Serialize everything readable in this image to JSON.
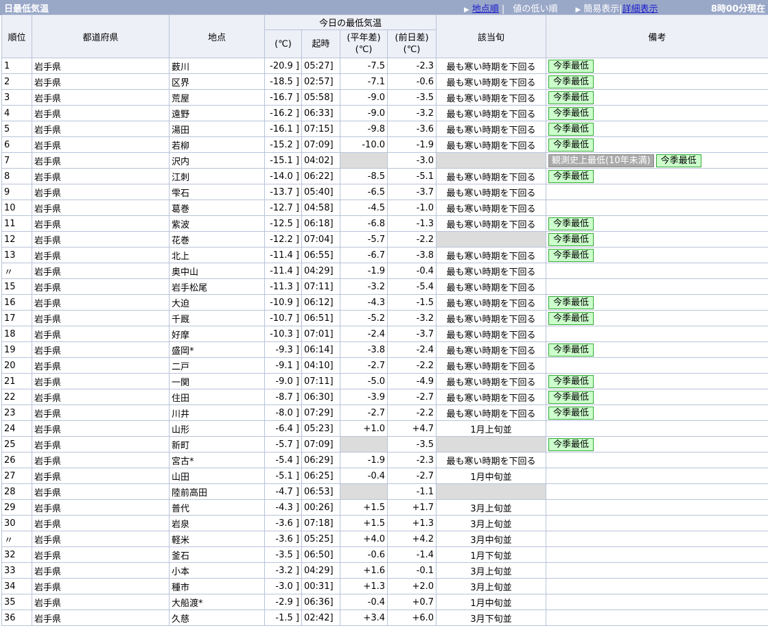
{
  "header": {
    "title": "日最低気温",
    "nav": [
      {
        "label": "地点順",
        "link": true
      },
      {
        "label": "値の低い順",
        "link": false
      },
      {
        "label": "簡易表示",
        "link": false
      },
      {
        "label": "詳細表示",
        "link": true
      }
    ],
    "nav_separator": "|",
    "time": "8時00分現在"
  },
  "columns": {
    "rank": "順位",
    "pref": "都道府県",
    "loc": "地点",
    "group": "今日の最低気温",
    "temp": "(℃)",
    "time": "起時",
    "normal_diff_1": "(平年差)",
    "normal_diff_2": "(℃)",
    "prev_diff_1": "(前日差)",
    "prev_diff_2": "(℃)",
    "period": "該当旬",
    "note": "備考"
  },
  "rows": [
    {
      "rank": "1",
      "pref": "岩手県",
      "loc": "薮川",
      "temp": "-20.9 ]",
      "time": "05:27]",
      "nd": "-7.5",
      "pd": "-2.3",
      "period": "最も寒い時期を下回る",
      "notes": [
        "今季最低"
      ]
    },
    {
      "rank": "2",
      "pref": "岩手県",
      "loc": "区界",
      "temp": "-18.5 ]",
      "time": "02:57]",
      "nd": "-7.1",
      "pd": "-0.6",
      "period": "最も寒い時期を下回る",
      "notes": [
        "今季最低"
      ]
    },
    {
      "rank": "3",
      "pref": "岩手県",
      "loc": "荒屋",
      "temp": "-16.7 ]",
      "time": "05:58]",
      "nd": "-9.0",
      "pd": "-3.5",
      "period": "最も寒い時期を下回る",
      "notes": [
        "今季最低"
      ]
    },
    {
      "rank": "4",
      "pref": "岩手県",
      "loc": "遠野",
      "temp": "-16.2 ]",
      "time": "06:33]",
      "nd": "-9.0",
      "pd": "-3.2",
      "period": "最も寒い時期を下回る",
      "notes": [
        "今季最低"
      ]
    },
    {
      "rank": "5",
      "pref": "岩手県",
      "loc": "湯田",
      "temp": "-16.1 ]",
      "time": "07:15]",
      "nd": "-9.8",
      "pd": "-3.6",
      "period": "最も寒い時期を下回る",
      "notes": [
        "今季最低"
      ]
    },
    {
      "rank": "6",
      "pref": "岩手県",
      "loc": "若柳",
      "temp": "-15.2 ]",
      "time": "07:09]",
      "nd": "-10.0",
      "pd": "-1.9",
      "period": "最も寒い時期を下回る",
      "notes": [
        "今季最低"
      ]
    },
    {
      "rank": "7",
      "pref": "岩手県",
      "loc": "沢内",
      "temp": "-15.1 ]",
      "time": "04:02]",
      "nd": "",
      "pd": "-3.0",
      "period": "",
      "notes": [
        "観測史上最低(10年未満)",
        "今季最低"
      ]
    },
    {
      "rank": "8",
      "pref": "岩手県",
      "loc": "江刺",
      "temp": "-14.0 ]",
      "time": "06:22]",
      "nd": "-8.5",
      "pd": "-5.1",
      "period": "最も寒い時期を下回る",
      "notes": [
        "今季最低"
      ]
    },
    {
      "rank": "9",
      "pref": "岩手県",
      "loc": "雫石",
      "temp": "-13.7 ]",
      "time": "05:40]",
      "nd": "-6.5",
      "pd": "-3.7",
      "period": "最も寒い時期を下回る",
      "notes": []
    },
    {
      "rank": "10",
      "pref": "岩手県",
      "loc": "葛巻",
      "temp": "-12.7 ]",
      "time": "04:58]",
      "nd": "-4.5",
      "pd": "-1.0",
      "period": "最も寒い時期を下回る",
      "notes": []
    },
    {
      "rank": "11",
      "pref": "岩手県",
      "loc": "紫波",
      "temp": "-12.5 ]",
      "time": "06:18]",
      "nd": "-6.8",
      "pd": "-1.3",
      "period": "最も寒い時期を下回る",
      "notes": [
        "今季最低"
      ]
    },
    {
      "rank": "12",
      "pref": "岩手県",
      "loc": "花巻",
      "temp": "-12.2 ]",
      "time": "07:04]",
      "nd": "-5.7",
      "pd": "-2.2",
      "period": "",
      "notes": [
        "今季最低"
      ]
    },
    {
      "rank": "13",
      "pref": "岩手県",
      "loc": "北上",
      "temp": "-11.4 ]",
      "time": "06:55]",
      "nd": "-6.7",
      "pd": "-3.8",
      "period": "最も寒い時期を下回る",
      "notes": [
        "今季最低"
      ]
    },
    {
      "rank": "〃",
      "pref": "岩手県",
      "loc": "奥中山",
      "temp": "-11.4 ]",
      "time": "04:29]",
      "nd": "-1.9",
      "pd": "-0.4",
      "period": "最も寒い時期を下回る",
      "notes": []
    },
    {
      "rank": "15",
      "pref": "岩手県",
      "loc": "岩手松尾",
      "temp": "-11.3 ]",
      "time": "07:11]",
      "nd": "-3.2",
      "pd": "-5.4",
      "period": "最も寒い時期を下回る",
      "notes": []
    },
    {
      "rank": "16",
      "pref": "岩手県",
      "loc": "大迫",
      "temp": "-10.9 ]",
      "time": "06:12]",
      "nd": "-4.3",
      "pd": "-1.5",
      "period": "最も寒い時期を下回る",
      "notes": [
        "今季最低"
      ]
    },
    {
      "rank": "17",
      "pref": "岩手県",
      "loc": "千厩",
      "temp": "-10.7 ]",
      "time": "06:51]",
      "nd": "-5.2",
      "pd": "-3.2",
      "period": "最も寒い時期を下回る",
      "notes": [
        "今季最低"
      ]
    },
    {
      "rank": "18",
      "pref": "岩手県",
      "loc": "好摩",
      "temp": "-10.3 ]",
      "time": "07:01]",
      "nd": "-2.4",
      "pd": "-3.7",
      "period": "最も寒い時期を下回る",
      "notes": []
    },
    {
      "rank": "19",
      "pref": "岩手県",
      "loc": "盛岡*",
      "temp": "-9.3 ]",
      "time": "06:14]",
      "nd": "-3.8",
      "pd": "-2.4",
      "period": "最も寒い時期を下回る",
      "notes": [
        "今季最低"
      ]
    },
    {
      "rank": "20",
      "pref": "岩手県",
      "loc": "二戸",
      "temp": "-9.1 ]",
      "time": "04:10]",
      "nd": "-2.7",
      "pd": "-2.2",
      "period": "最も寒い時期を下回る",
      "notes": []
    },
    {
      "rank": "21",
      "pref": "岩手県",
      "loc": "一関",
      "temp": "-9.0 ]",
      "time": "07:11]",
      "nd": "-5.0",
      "pd": "-4.9",
      "period": "最も寒い時期を下回る",
      "notes": [
        "今季最低"
      ]
    },
    {
      "rank": "22",
      "pref": "岩手県",
      "loc": "住田",
      "temp": "-8.7 ]",
      "time": "06:30]",
      "nd": "-3.9",
      "pd": "-2.7",
      "period": "最も寒い時期を下回る",
      "notes": [
        "今季最低"
      ]
    },
    {
      "rank": "23",
      "pref": "岩手県",
      "loc": "川井",
      "temp": "-8.0 ]",
      "time": "07:29]",
      "nd": "-2.7",
      "pd": "-2.2",
      "period": "最も寒い時期を下回る",
      "notes": [
        "今季最低"
      ]
    },
    {
      "rank": "24",
      "pref": "岩手県",
      "loc": "山形",
      "temp": "-6.4 ]",
      "time": "05:23]",
      "nd": "+1.0",
      "pd": "+4.7",
      "period": "1月上旬並",
      "notes": []
    },
    {
      "rank": "25",
      "pref": "岩手県",
      "loc": "新町",
      "temp": "-5.7 ]",
      "time": "07:09]",
      "nd": "",
      "pd": "-3.5",
      "period": "",
      "notes": [
        "今季最低"
      ]
    },
    {
      "rank": "26",
      "pref": "岩手県",
      "loc": "宮古*",
      "temp": "-5.4 ]",
      "time": "06:29]",
      "nd": "-1.9",
      "pd": "-2.3",
      "period": "最も寒い時期を下回る",
      "notes": []
    },
    {
      "rank": "27",
      "pref": "岩手県",
      "loc": "山田",
      "temp": "-5.1 ]",
      "time": "06:25]",
      "nd": "-0.4",
      "pd": "-2.7",
      "period": "1月中旬並",
      "notes": []
    },
    {
      "rank": "28",
      "pref": "岩手県",
      "loc": "陸前高田",
      "temp": "-4.7 ]",
      "time": "06:53]",
      "nd": "",
      "pd": "-1.1",
      "period": "",
      "notes": []
    },
    {
      "rank": "29",
      "pref": "岩手県",
      "loc": "普代",
      "temp": "-4.3 ]",
      "time": "00:26]",
      "nd": "+1.5",
      "pd": "+1.7",
      "period": "3月上旬並",
      "notes": []
    },
    {
      "rank": "30",
      "pref": "岩手県",
      "loc": "岩泉",
      "temp": "-3.6 ]",
      "time": "07:18]",
      "nd": "+1.5",
      "pd": "+1.3",
      "period": "3月上旬並",
      "notes": []
    },
    {
      "rank": "〃",
      "pref": "岩手県",
      "loc": "軽米",
      "temp": "-3.6 ]",
      "time": "05:25]",
      "nd": "+4.0",
      "pd": "+4.2",
      "period": "3月中旬並",
      "notes": []
    },
    {
      "rank": "32",
      "pref": "岩手県",
      "loc": "釜石",
      "temp": "-3.5 ]",
      "time": "06:50]",
      "nd": "-0.6",
      "pd": "-1.4",
      "period": "1月下旬並",
      "notes": []
    },
    {
      "rank": "33",
      "pref": "岩手県",
      "loc": "小本",
      "temp": "-3.2 ]",
      "time": "04:29]",
      "nd": "+1.6",
      "pd": "-0.1",
      "period": "3月上旬並",
      "notes": []
    },
    {
      "rank": "34",
      "pref": "岩手県",
      "loc": "種市",
      "temp": "-3.0 ]",
      "time": "00:31]",
      "nd": "+1.3",
      "pd": "+2.0",
      "period": "3月上旬並",
      "notes": []
    },
    {
      "rank": "35",
      "pref": "岩手県",
      "loc": "大船渡*",
      "temp": "-2.9 ]",
      "time": "06:36]",
      "nd": "-0.4",
      "pd": "+0.7",
      "period": "1月中旬並",
      "notes": []
    },
    {
      "rank": "36",
      "pref": "岩手県",
      "loc": "久慈",
      "temp": "-1.5 ]",
      "time": "02:42]",
      "nd": "+3.4",
      "pd": "+6.0",
      "period": "3月下旬並",
      "notes": []
    }
  ],
  "colors": {
    "header_bar": "#9aa8c8",
    "badge_green_bg": "#ccffcc",
    "badge_gray_bg": "#aaaaaa",
    "empty_cell": "#dcdcdc"
  }
}
